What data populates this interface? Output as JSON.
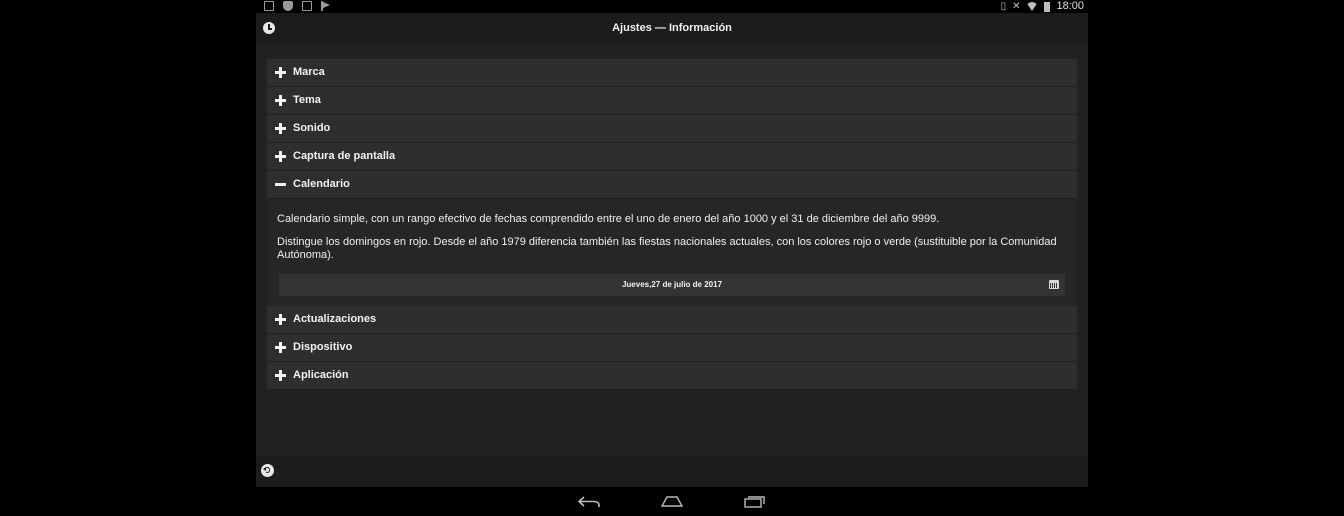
{
  "status_bar": {
    "left_icons": [
      "screen-icon",
      "shield-icon",
      "image-icon",
      "flag-icon"
    ],
    "right_icons": [
      "vibrate-icon",
      "mute-icon",
      "wifi-icon",
      "battery-icon"
    ],
    "time": "18:00"
  },
  "header": {
    "title": "Ajustes — Información",
    "icon": "clock-icon"
  },
  "sections": [
    {
      "label": "Marca",
      "expanded": false
    },
    {
      "label": "Tema",
      "expanded": false
    },
    {
      "label": "Sonido",
      "expanded": false
    },
    {
      "label": "Captura de pantalla",
      "expanded": false
    },
    {
      "label": "Calendario",
      "expanded": true
    },
    {
      "label": "Actualizaciones",
      "expanded": false
    },
    {
      "label": "Dispositivo",
      "expanded": false
    },
    {
      "label": "Aplicación",
      "expanded": false
    }
  ],
  "calendar": {
    "description_1": "Calendario simple, con un rango efectivo de fechas comprendido entre el uno de enero del año 1000 y el 31 de diciembre del año 9999.",
    "description_2": "Distingue los domingos en rojo. Desde el año 1979 diferencia también las fiestas nacionales actuales, con los colores rojo o verde (sustituible por la Comunidad Autónoma).",
    "date": "Jueves,27 de julio de 2017",
    "date_icon": "calendar-icon"
  },
  "footer": {
    "icon": "undo-icon"
  },
  "navigation": {
    "icons": [
      "back-icon",
      "home-icon",
      "recents-icon"
    ]
  },
  "colors": {
    "background": "#222222",
    "row": "#2e2e2e",
    "text": "#f2f2f2"
  }
}
